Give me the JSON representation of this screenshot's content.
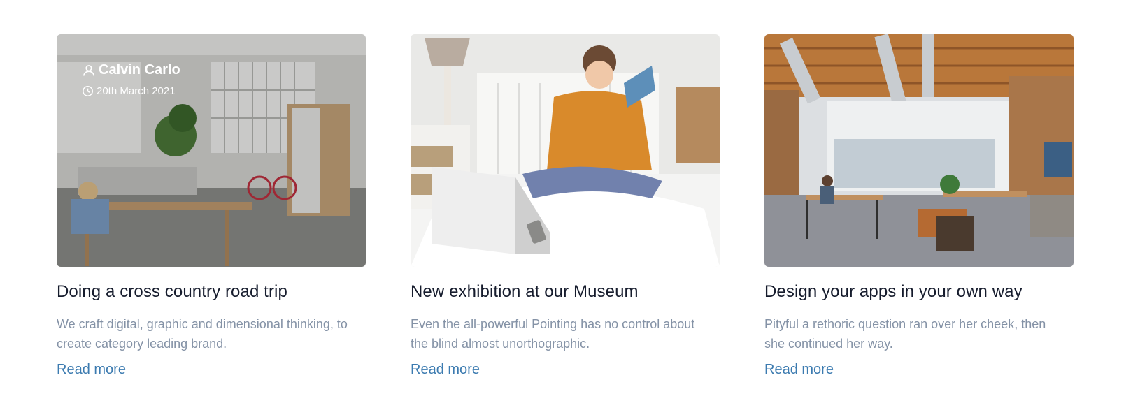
{
  "cards": [
    {
      "title": "Doing a cross country road trip",
      "description": "We craft digital, graphic and dimensional thinking, to create category leading brand.",
      "link": "Read more",
      "author": "Calvin Carlo",
      "date": "20th March 2021"
    },
    {
      "title": "New exhibition at our Museum",
      "description": "Even the all-powerful Pointing has no control about the blind almost unorthographic.",
      "link": "Read more"
    },
    {
      "title": "Design your apps in your own way",
      "description": "Pityful a rethoric question ran over her cheek, then she continued her way.",
      "link": "Read more"
    }
  ],
  "colors": {
    "link": "#3c7bb0",
    "title": "#161c2d",
    "description": "#8492a6"
  },
  "icons": [
    "user-icon",
    "clock-icon"
  ]
}
